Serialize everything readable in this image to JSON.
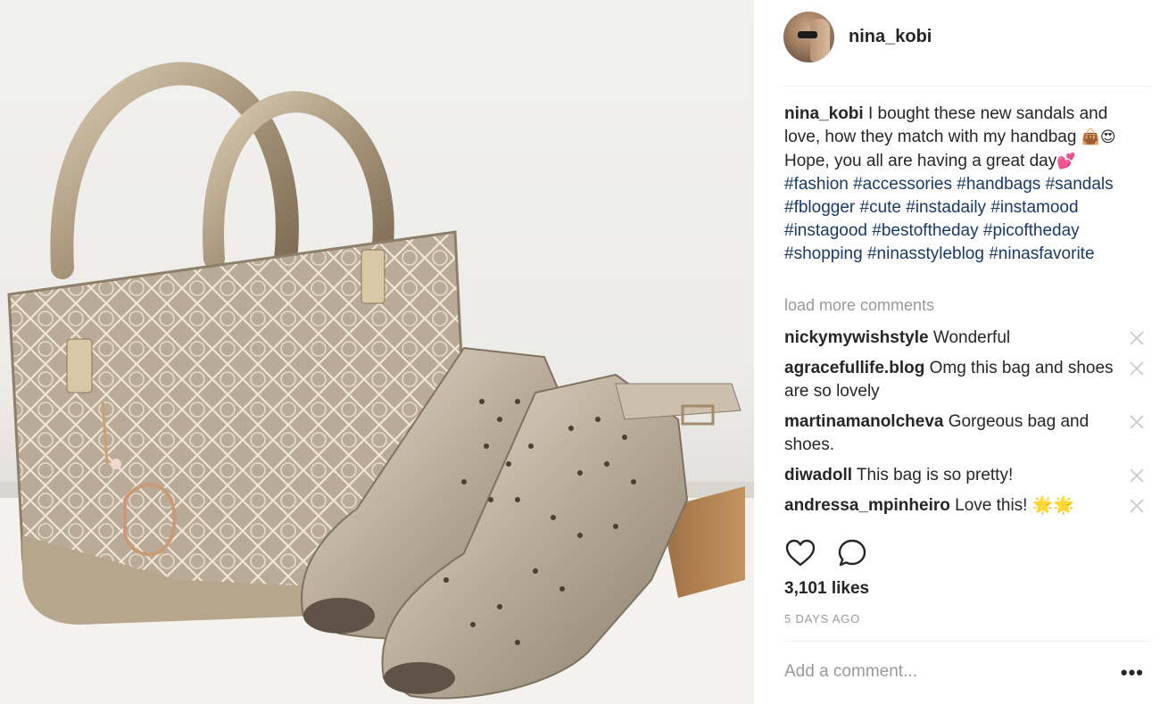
{
  "post": {
    "author": "nina_kobi",
    "caption_parts": {
      "author": "nina_kobi",
      "text1": " I bought these new sandals and love, how they match with my handbag ",
      "emoji1": "👜😍",
      "text2": " Hope, you all are having a great day",
      "emoji2": "💕",
      "tags": "#fashion #accessories #handbags #sandals #fblogger #cute #instadaily #instamood #instagood #bestoftheday #picoftheday #shopping #ninasstyleblog #ninasfavorite"
    },
    "load_more": "load more comments",
    "comments": [
      {
        "user": "nickymywishstyle",
        "text": " Wonderful"
      },
      {
        "user": "agracefullife.blog",
        "text": " Omg this bag and shoes are so lovely"
      },
      {
        "user": "martinamanolcheva",
        "text": " Gorgeous bag and shoes."
      },
      {
        "user": "diwadoll",
        "text": " This bag is so pretty!"
      },
      {
        "user": "andressa_mpinheiro",
        "text": " Love this! 🌟🌟"
      }
    ],
    "likes": "3,101 likes",
    "timestamp": "5 DAYS AGO",
    "add_comment_placeholder": "Add a comment...",
    "more_label": "•••"
  },
  "icons": {
    "like": "heart-icon",
    "comment": "comment-bubble-icon",
    "close": "close-icon",
    "more": "more-options-icon"
  },
  "colors": {
    "hashtag": "#1a3a66",
    "muted": "#999999",
    "text": "#262626"
  }
}
